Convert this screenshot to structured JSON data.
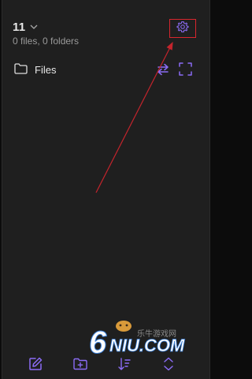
{
  "header": {
    "vault_name": "11",
    "vault_stats": "0 files, 0 folders"
  },
  "files": {
    "label": "Files"
  },
  "icons": {
    "vault_dropdown": "chevron-down-icon",
    "settings": "gear-icon",
    "folder": "folder-icon",
    "sync": "swap-arrows-icon",
    "expand": "expand-corners-icon",
    "new_note": "edit-note-icon",
    "new_folder": "new-folder-icon",
    "sort": "sort-icon",
    "collapse": "expand-collapse-icon"
  },
  "watermark": {
    "text": "乐牛游戏网",
    "logo": "6NIU.COM"
  },
  "colors": {
    "accent": "#8b6cf6",
    "highlight_box": "#d8262e",
    "annotation_arrow": "#c4242c",
    "background": "#1f1f1f",
    "text_primary": "#e8e8e8",
    "text_secondary": "#9a9a9a"
  }
}
